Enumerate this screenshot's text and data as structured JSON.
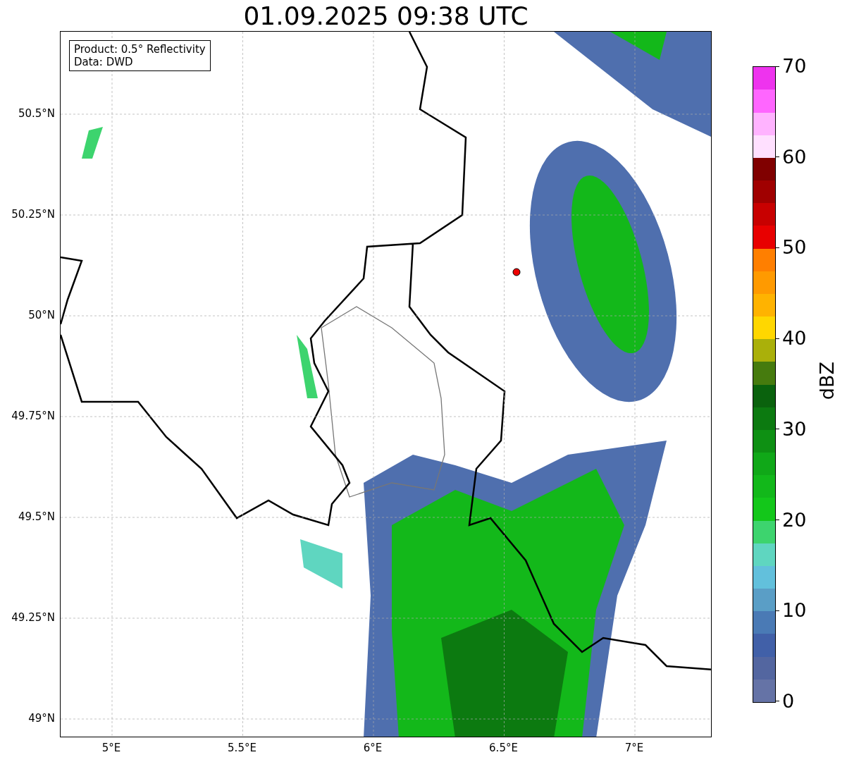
{
  "title": "01.09.2025 09:38 UTC",
  "info_box": [
    "Product: 0.5° Reflectivity",
    "Data: DWD"
  ],
  "y_ticks": [
    "50.5°N",
    "50.25°N",
    "50°N",
    "49.75°N",
    "49.5°N",
    "49.25°N",
    "49°N"
  ],
  "x_ticks": [
    "5°E",
    "5.5°E",
    "6°E",
    "6.5°E",
    "7°E"
  ],
  "colorbar": {
    "label": "dBZ",
    "ticks": [
      "70",
      "60",
      "50",
      "40",
      "30",
      "20",
      "10",
      "0"
    ],
    "levels": [
      {
        "color": "#6573a6"
      },
      {
        "color": "#5366a0"
      },
      {
        "color": "#4160a8"
      },
      {
        "color": "#4a7ab5"
      },
      {
        "color": "#5a9ec6"
      },
      {
        "color": "#62c0dc"
      },
      {
        "color": "#5fd6c0"
      },
      {
        "color": "#3dd46e"
      },
      {
        "color": "#13c71a"
      },
      {
        "color": "#12b81a"
      },
      {
        "color": "#10a818"
      },
      {
        "color": "#0e9013"
      },
      {
        "color": "#0c7a10"
      },
      {
        "color": "#0a620d"
      },
      {
        "color": "#467b0e"
      },
      {
        "color": "#aab00a"
      },
      {
        "color": "#ffd700"
      },
      {
        "color": "#ffb300"
      },
      {
        "color": "#ff9a00"
      },
      {
        "color": "#ff7f00"
      },
      {
        "color": "#e80000"
      },
      {
        "color": "#c80000"
      },
      {
        "color": "#a00000"
      },
      {
        "color": "#800000"
      },
      {
        "color": "#ffe0ff"
      },
      {
        "color": "#ffb3ff"
      },
      {
        "color": "#ff66ff"
      },
      {
        "color": "#ee33ee"
      }
    ]
  }
}
